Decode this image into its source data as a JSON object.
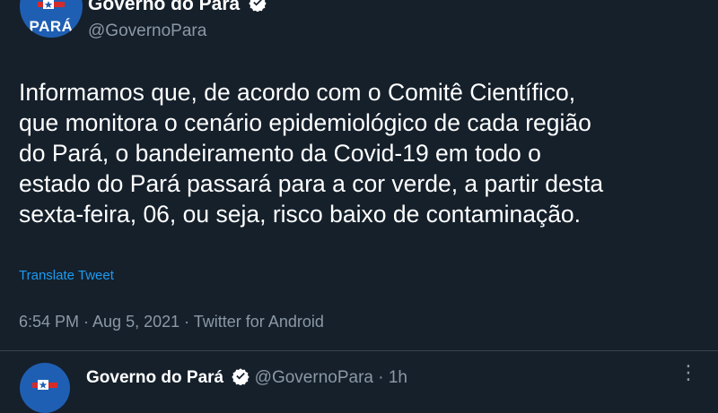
{
  "tweet": {
    "author_name": "Governo do Pará",
    "handle": "@GovernoPara",
    "avatar_text": "PARÁ",
    "lines": [
      "Informamos que, de acordo com o Comitê Científico,",
      "que monitora o cenário epidemiológico de cada região",
      "do Pará, o bandeiramento da Covid-19 em todo o",
      "estado do Pará passará para a cor verde, a partir desta",
      "sexta-feira, 06, ou seja, risco baixo de contaminação."
    ],
    "translate_label": "Translate Tweet",
    "meta": "6:54 PM · Aug 5, 2021 · Twitter for Android"
  },
  "reply": {
    "author_name": "Governo do Pará",
    "handle_time": "@GovernoPara · 1h",
    "more_icon": "⋮"
  },
  "colors": {
    "background": "#15202b",
    "secondary_text": "#8b98a5",
    "link": "#1d9bf0",
    "avatar": "#1f5fb3",
    "flag_red": "#d62b2b"
  },
  "icons": [
    "verified-badge-icon",
    "star-icon",
    "more-options-icon"
  ]
}
